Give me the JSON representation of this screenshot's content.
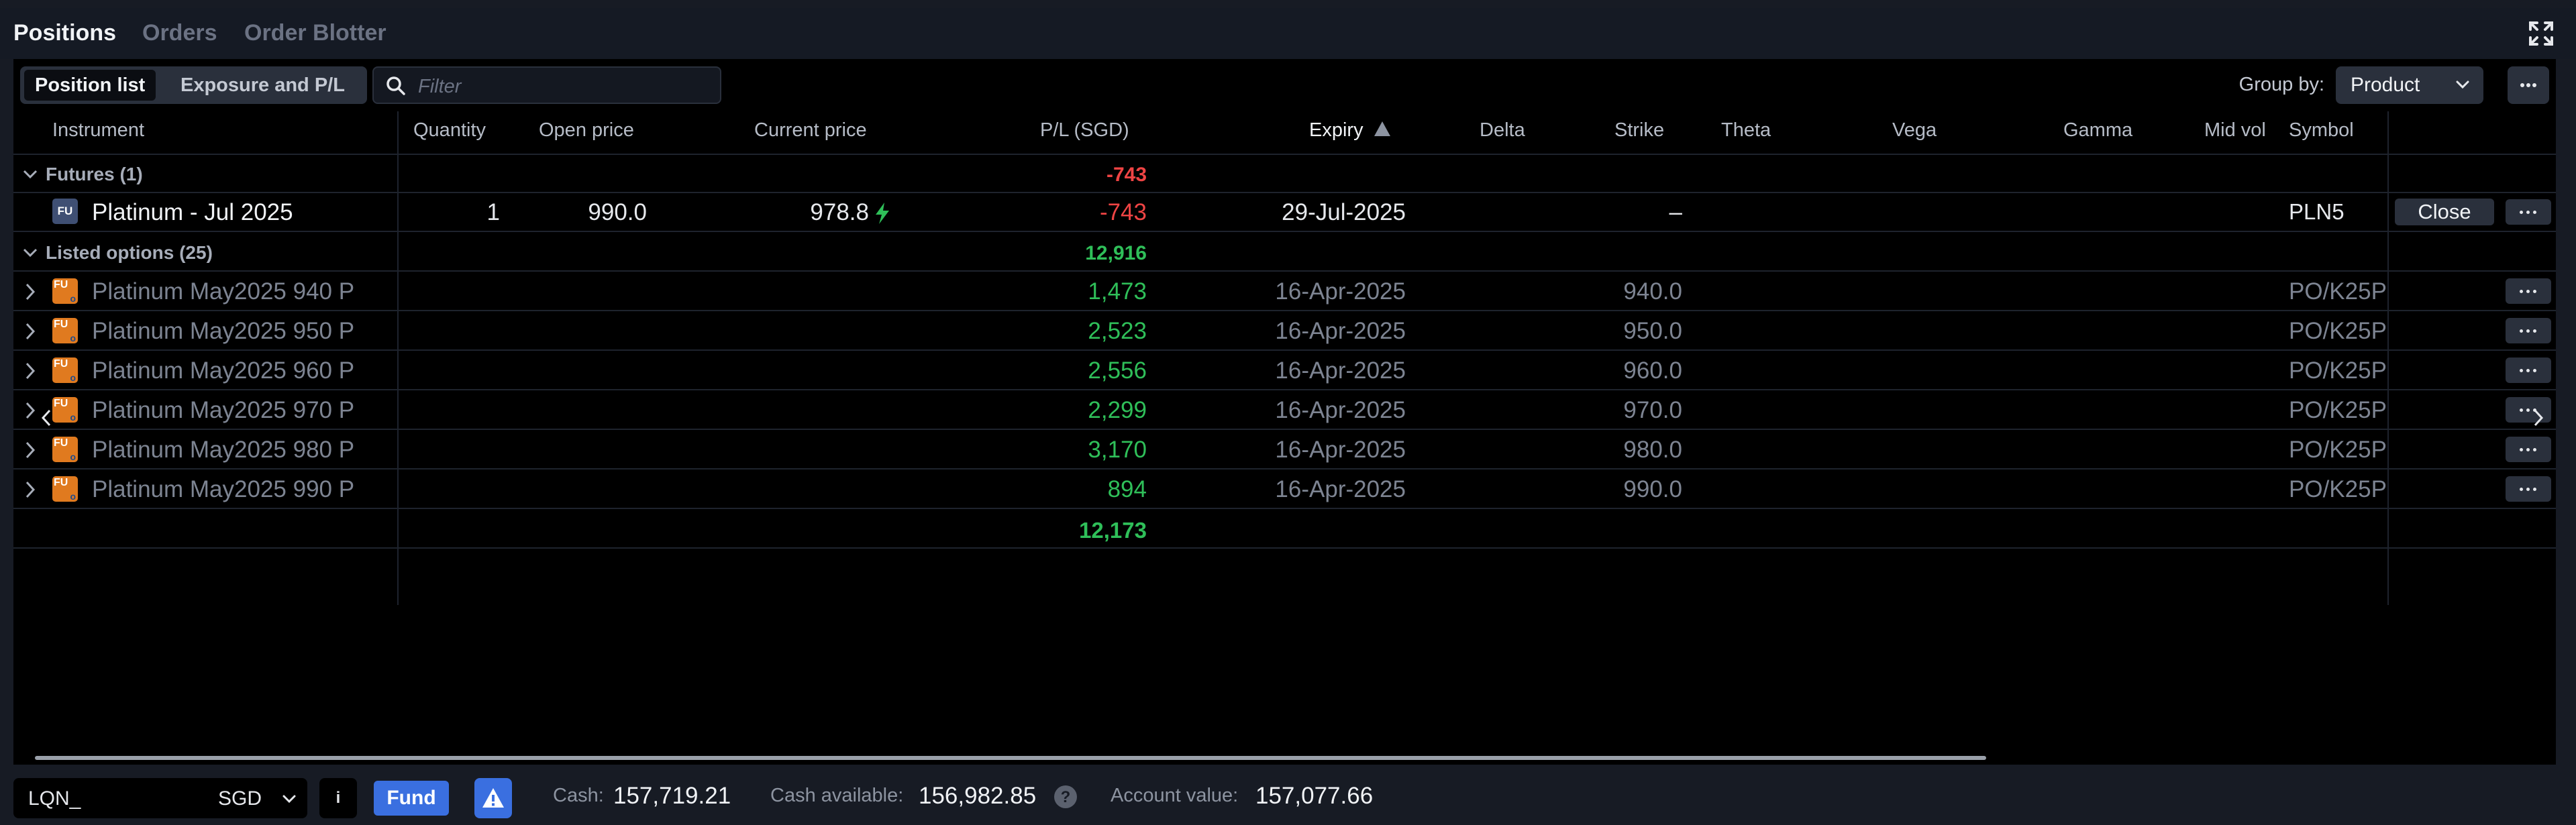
{
  "top_tabs": [
    "Positions",
    "Orders",
    "Order Blotter"
  ],
  "toolbar": {
    "view_tabs": [
      "Position list",
      "Exposure and P/L"
    ],
    "filter_placeholder": "Filter",
    "group_by_label": "Group by:",
    "group_by_value": "Product"
  },
  "columns": [
    "Instrument",
    "Quantity",
    "Open price",
    "Current price",
    "P/L (SGD)",
    "Expiry",
    "Delta",
    "Strike",
    "Theta",
    "Vega",
    "Gamma",
    "Mid vol",
    "Symbol"
  ],
  "sort": {
    "column": "Expiry",
    "direction": "ascending"
  },
  "groups": {
    "futures": {
      "label": "Futures (1)",
      "pl": "-743",
      "rows": [
        {
          "type_badge": "FU",
          "instrument": "Platinum - Jul 2025",
          "quantity": "1",
          "open_price": "990.0",
          "current_price": "978.8",
          "pl": "-743",
          "expiry": "29-Jul-2025",
          "strike": "–",
          "symbol": "PLN5",
          "close_label": "Close"
        }
      ]
    },
    "options": {
      "label": "Listed options (25)",
      "pl": "12,916",
      "rows": [
        {
          "type_badge": "FU",
          "instrument": "Platinum May2025 940 P",
          "pl": "1,473",
          "expiry": "16-Apr-2025",
          "strike": "940.0",
          "symbol": "PO/K25P"
        },
        {
          "type_badge": "FU",
          "instrument": "Platinum May2025 950 P",
          "pl": "2,523",
          "expiry": "16-Apr-2025",
          "strike": "950.0",
          "symbol": "PO/K25P"
        },
        {
          "type_badge": "FU",
          "instrument": "Platinum May2025 960 P",
          "pl": "2,556",
          "expiry": "16-Apr-2025",
          "strike": "960.0",
          "symbol": "PO/K25P"
        },
        {
          "type_badge": "FU",
          "instrument": "Platinum May2025 970 P",
          "pl": "2,299",
          "expiry": "16-Apr-2025",
          "strike": "970.0",
          "symbol": "PO/K25P"
        },
        {
          "type_badge": "FU",
          "instrument": "Platinum May2025 980 P",
          "pl": "3,170",
          "expiry": "16-Apr-2025",
          "strike": "980.0",
          "symbol": "PO/K25P"
        },
        {
          "type_badge": "FU",
          "instrument": "Platinum May2025 990 P",
          "pl": "894",
          "expiry": "16-Apr-2025",
          "strike": "990.0",
          "symbol": "PO/K25P"
        }
      ]
    }
  },
  "total_pl": "12,173",
  "footer": {
    "account_id": "LQN_",
    "currency": "SGD",
    "info_label": "i",
    "fund_label": "Fund",
    "cash_label": "Cash:",
    "cash_value": "157,719.21",
    "cash_available_label": "Cash available:",
    "cash_available_value": "156,982.85",
    "account_value_label": "Account value:",
    "account_value_value": "157,077.66"
  },
  "colors": {
    "positive": "#2fbf59",
    "negative": "#ef4444",
    "accent": "#3a6fe0",
    "background": "#000000"
  }
}
